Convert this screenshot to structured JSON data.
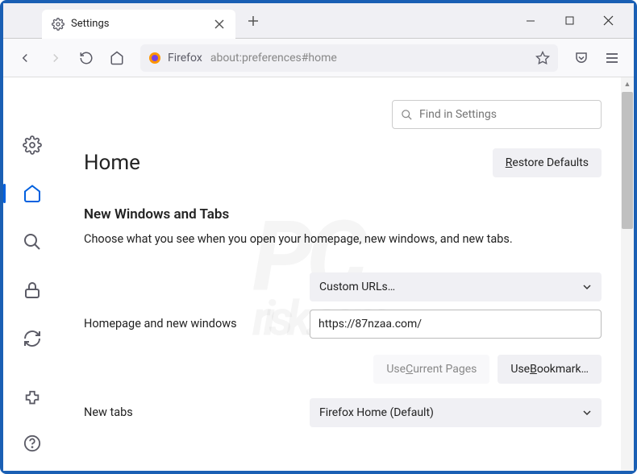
{
  "tab": {
    "title": "Settings"
  },
  "urlbar": {
    "identity": "Firefox",
    "url": "about:preferences#home"
  },
  "search": {
    "placeholder": "Find in Settings"
  },
  "page": {
    "title": "Home",
    "restore_label": "Restore Defaults",
    "restore_accesskey": "R",
    "section_title": "New Windows and Tabs",
    "section_desc": "Choose what you see when you open your homepage, new windows, and new tabs."
  },
  "form": {
    "homepage_label": "Homepage and new windows",
    "homepage_dropdown": "Custom URLs…",
    "homepage_url": "https://87nzaa.com/",
    "use_current_label": "Use Current Pages",
    "use_current_accesskey": "C",
    "use_bookmark_label": "Use Bookmark…",
    "use_bookmark_accesskey": "B",
    "newtabs_label": "New tabs",
    "newtabs_dropdown": "Firefox Home (Default)"
  }
}
